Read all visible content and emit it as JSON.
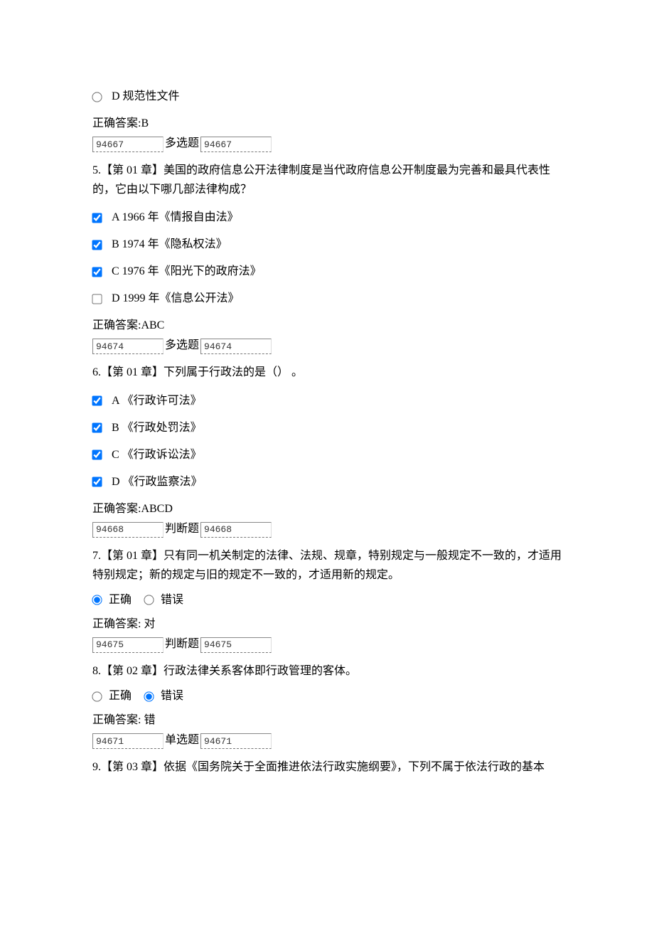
{
  "q4": {
    "optD": "D 规范性文件",
    "answer": "正确答案:B",
    "code1": "94667",
    "type": "多选题",
    "code2": "94667"
  },
  "q5": {
    "text": "5.【第 01 章】美国的政府信息公开法律制度是当代政府信息公开制度最为完善和最具代表性的，它由以下哪几部法律构成？",
    "optA": "A 1966 年《情报自由法》",
    "optB": "B 1974 年《隐私权法》",
    "optC": "C 1976 年《阳光下的政府法》",
    "optD": "D 1999 年《信息公开法》",
    "answer": "正确答案:ABC",
    "code1": "94674",
    "type": "多选题",
    "code2": "94674"
  },
  "q6": {
    "text": "6.【第 01 章】下列属于行政法的是（） 。",
    "optA": "A  《行政许可法》",
    "optB": "B  《行政处罚法》",
    "optC": "C  《行政诉讼法》",
    "optD": "D  《行政监察法》",
    "answer": "正确答案:ABCD",
    "code1": "94668",
    "type": "判断题",
    "code2": "94668"
  },
  "q7": {
    "text": "7.【第 01 章】只有同一机关制定的法律、法规、规章，特别规定与一般规定不一致的，才适用特别规定；新的规定与旧的规定不一致的，才适用新的规定。",
    "true": "正确",
    "false": "错误",
    "answer": "正确答案: 对",
    "code1": "94675",
    "type": "判断题",
    "code2": "94675"
  },
  "q8": {
    "text": "8.【第 02 章】行政法律关系客体即行政管理的客体。",
    "true": "正确",
    "false": "错误",
    "answer": "正确答案: 错",
    "code1": "94671",
    "type": "单选题",
    "code2": "94671"
  },
  "q9": {
    "text": "9.【第 03 章】依据《国务院关于全面推进依法行政实施纲要》，下列不属于依法行政的基本"
  }
}
